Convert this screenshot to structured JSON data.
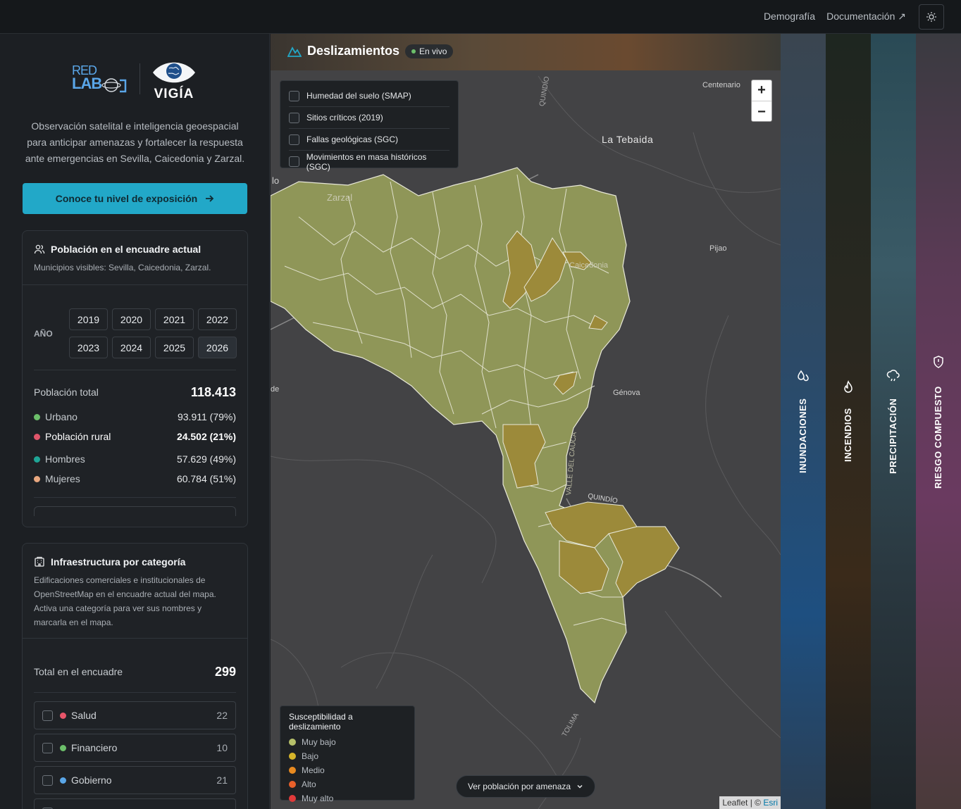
{
  "topbar": {
    "nav": [
      {
        "label": "Demografía"
      },
      {
        "label": "Documentación ↗"
      }
    ],
    "theme_icon": "sun-icon"
  },
  "sidebar": {
    "logo_left": {
      "line1": "RED",
      "line2": "LAB"
    },
    "logo_right": "VIGÍA",
    "description": "Observación satelital e inteligencia geoespacial para anticipar amenazas y fortalecer la respuesta ante emergencias en Sevilla, Caicedonia y Zarzal.",
    "cta_label": "Conoce tu nivel de exposición",
    "population_card": {
      "title": "Población en el encuadre actual",
      "subtitle": "Municipios visibles: Sevilla, Caicedonia, Zarzal.",
      "year_label": "AÑO",
      "years": [
        "2019",
        "2020",
        "2021",
        "2022",
        "2023",
        "2024",
        "2025",
        "2026"
      ],
      "selected_year": "2026",
      "total_label": "Población total",
      "total_value": "118.413",
      "rows": [
        {
          "label": "Urbano",
          "value": "93.911 (79%)",
          "color": "#6cbf6a"
        },
        {
          "label": "Población rural",
          "value": "24.502 (21%)",
          "color": "#e0556a"
        },
        {
          "label": "Hombres",
          "value": "57.629 (49%)",
          "color": "#1fa596"
        },
        {
          "label": "Mujeres",
          "value": "60.784 (51%)",
          "color": "#e8a77f"
        }
      ]
    },
    "infra_card": {
      "title": "Infraestructura por categoría",
      "subtitle": "Edificaciones comerciales e institucionales de OpenStreetMap en el encuadre actual del mapa. Activa una categoría para ver sus nombres y marcarla en el mapa.",
      "total_label": "Total en el encuadre",
      "total_value": "299",
      "items": [
        {
          "label": "Salud",
          "count": "22",
          "color": "#e8556a"
        },
        {
          "label": "Financiero",
          "count": "10",
          "color": "#6cbf6a"
        },
        {
          "label": "Gobierno",
          "count": "21",
          "color": "#5aa6e8"
        }
      ]
    }
  },
  "map": {
    "title": "Deslizamientos",
    "live_label": "En vivo",
    "layers": [
      {
        "label": "Humedad del suelo (SMAP)"
      },
      {
        "label": "Sitios críticos (2019)"
      },
      {
        "label": "Fallas geológicas (SGC)"
      },
      {
        "label": "Movimientos en masa históricos (SGC)"
      }
    ],
    "zoom_in": "+",
    "zoom_out": "−",
    "place_labels": {
      "tebaida": "La Tebaida",
      "centenario": "Centenario",
      "pijao": "Pijao",
      "genova": "Génova",
      "zarzal": "Zarzal",
      "caicedonia": "Caicedonia",
      "quindio1": "QUINDÍO",
      "quindio2": "QUINDÍO",
      "tolima": "TOLIMA",
      "valle": "VALLE DEL CAUCA",
      "lo": "lo",
      "de": "de"
    },
    "legend": {
      "title": "Susceptibilidad a deslizamiento",
      "items": [
        {
          "label": "Muy bajo",
          "color": "#b6c06a"
        },
        {
          "label": "Bajo",
          "color": "#d6b52a"
        },
        {
          "label": "Medio",
          "color": "#e88a20"
        },
        {
          "label": "Alto",
          "color": "#e8602a"
        },
        {
          "label": "Muy alto",
          "color": "#e03a3a"
        }
      ]
    },
    "population_button": "Ver población por amenaza",
    "attribution": {
      "leaflet": "Leaflet",
      "sep": " | © ",
      "esri": "Esri"
    }
  },
  "strips": [
    {
      "label": "INUNDACIONES",
      "icon": "droplets-icon"
    },
    {
      "label": "INCENDIOS",
      "icon": "flame-icon"
    },
    {
      "label": "PRECIPITACIÓN",
      "icon": "cloud-rain-icon"
    },
    {
      "label": "RIESGO COMPUESTO",
      "icon": "shield-alert-icon"
    }
  ]
}
